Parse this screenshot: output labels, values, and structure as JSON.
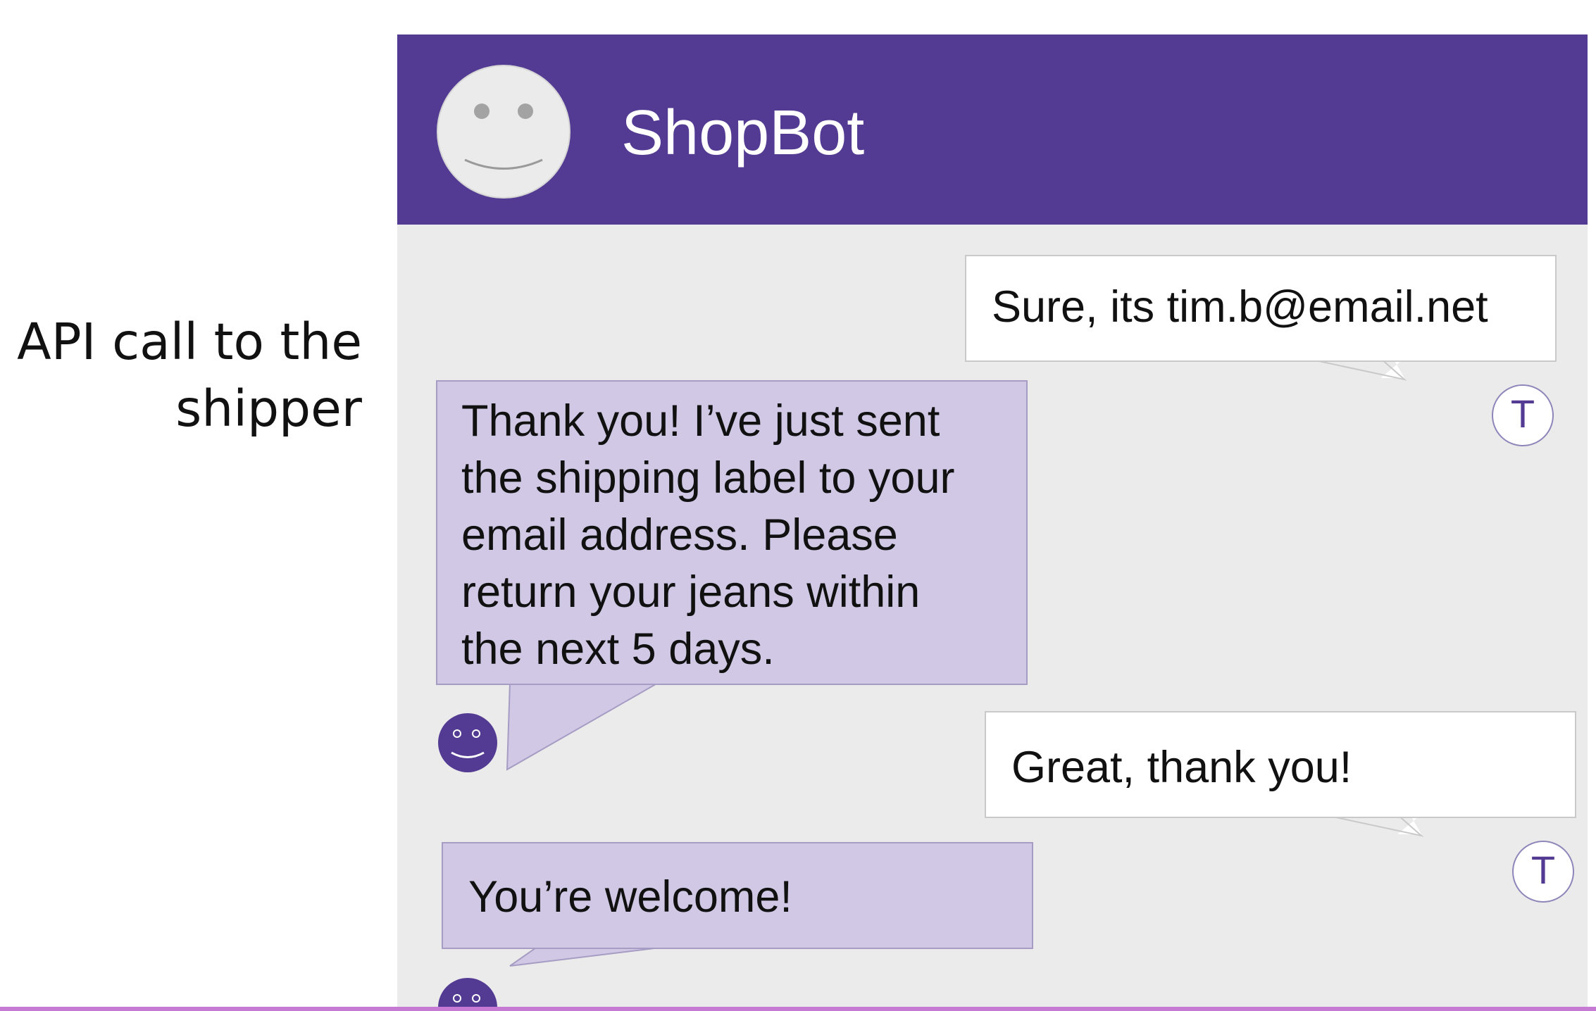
{
  "side_label": {
    "line1": "API call to the",
    "line2": "shipper"
  },
  "header": {
    "title": "ShopBot",
    "avatar_icon": "smiley-face-icon"
  },
  "user_avatar_letter": "T",
  "messages": [
    {
      "sender": "user",
      "text": "Sure, its tim.b@email.net"
    },
    {
      "sender": "bot",
      "lines": [
        "Thank you! I’ve just sent",
        "the shipping label to your",
        "email address. Please",
        "return your jeans within",
        "the next 5 days."
      ]
    },
    {
      "sender": "user",
      "text": "Great, thank you!"
    },
    {
      "sender": "bot",
      "text": "You’re welcome!"
    }
  ],
  "colors": {
    "header": "#533b93",
    "bot_bubble": "#d0c8e4",
    "user_bubble": "#ffffff",
    "chat_background": "#ebebeb"
  }
}
